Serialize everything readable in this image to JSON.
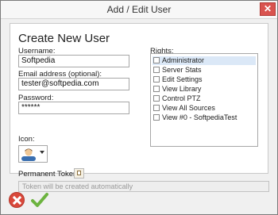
{
  "window": {
    "title": "Add / Edit User",
    "close_label": "✕"
  },
  "form": {
    "heading": "Create New User",
    "username_label": "Username:",
    "username_value": "Softpedia",
    "email_label": "Email address (optional):",
    "email_value": "tester@softpedia.com",
    "password_label": "Password:",
    "password_value": "******",
    "icon_label": "Icon:",
    "icon_name": "user-avatar-icon",
    "permanent_token_label": "Permanent Token:",
    "token_placeholder": "Token will be created automatically"
  },
  "rights": {
    "label": "Rights:",
    "items": [
      {
        "label": "Administrator",
        "checked": false,
        "selected": true
      },
      {
        "label": "Server Stats",
        "checked": false
      },
      {
        "label": "Edit Settings",
        "checked": false
      },
      {
        "label": "View Library",
        "checked": false
      },
      {
        "label": "Control PTZ",
        "checked": false
      },
      {
        "label": "View All Sources",
        "checked": false
      },
      {
        "label": "View #0 - SoftpediaTest",
        "checked": false
      }
    ]
  },
  "actions": {
    "cancel_icon": "cancel-icon",
    "ok_icon": "checkmark-icon"
  },
  "colors": {
    "cancel": "#d9483b",
    "ok": "#6cb33f",
    "selected_row": "#dbe8f7"
  }
}
